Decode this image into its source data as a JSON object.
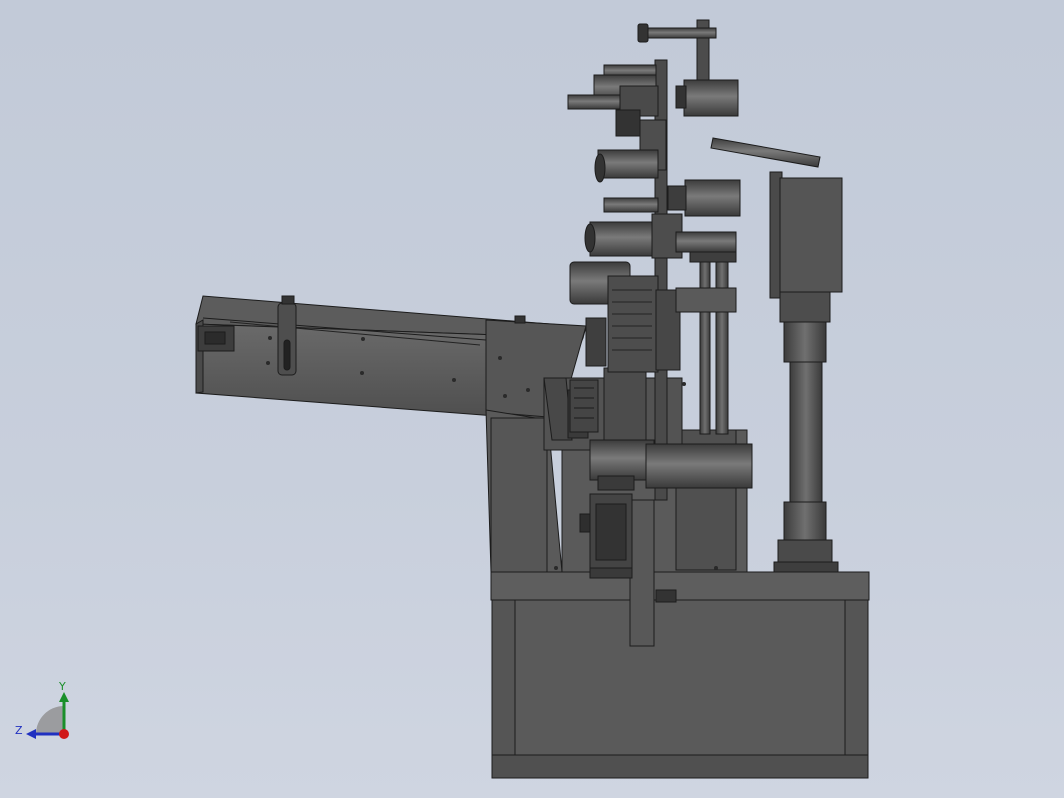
{
  "view": {
    "colors": {
      "background_top": "#c2cad8",
      "background_bottom": "#cfd5e1",
      "part_dark": "#4a4a4a",
      "part_mid": "#5b5b5b",
      "part_light": "#6a6a6a",
      "edge": "#1c1c1c"
    }
  },
  "triad": {
    "x_label": "",
    "y_label": "Y",
    "z_label": "Z",
    "colors": {
      "y": "#1a8f2a",
      "z": "#2030c0",
      "x": "#d01818"
    }
  }
}
